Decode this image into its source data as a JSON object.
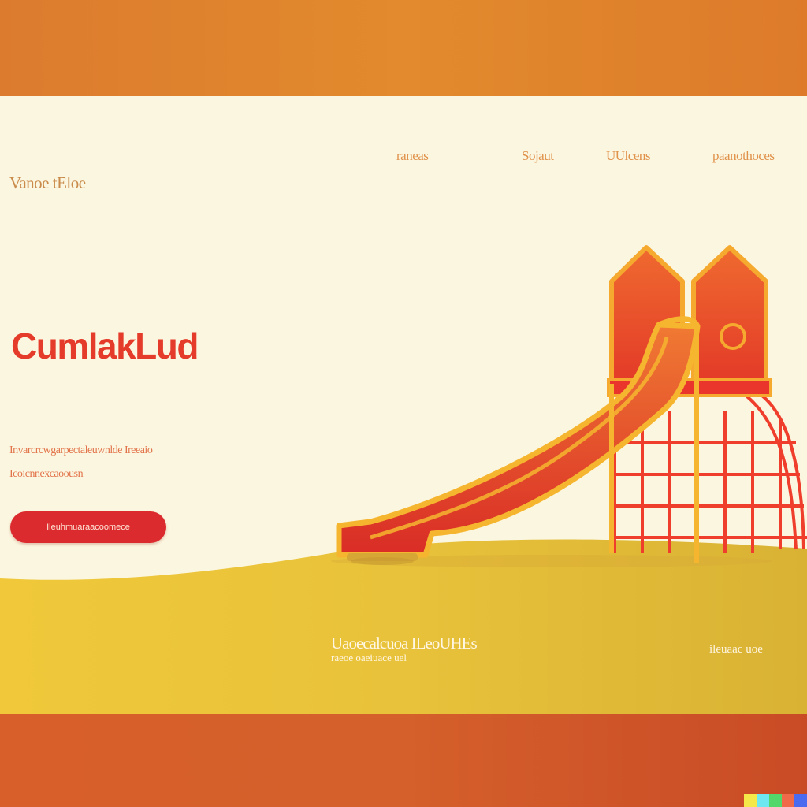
{
  "brand": {
    "name": "Vanoe tEloe"
  },
  "nav": {
    "items": [
      {
        "label": "raneas"
      },
      {
        "label": "Sojaut"
      },
      {
        "label": "UUlcens"
      },
      {
        "label": "paanothoces"
      }
    ]
  },
  "hero": {
    "title": "CumlakLud",
    "description_line1": "Invarcrcwgarpectaleuwnlde Ireeaio",
    "description_line2": "Icoicnnexcaoousn",
    "cta_label": "Ileuhmuaraacoomece"
  },
  "footer": {
    "headline": "Uaoecalcuoa ILeoUHEs",
    "subline": "raeoe oaeiuace uel",
    "right_text": "ileuaac uoe"
  },
  "colors": {
    "accent_red": "#dc2b2f",
    "title_red": "#e53b2a",
    "nav_orange": "#e0914a",
    "page_cream": "#fbf6df",
    "ground_yellow": "#ecc63a",
    "band_orange": "#e28a2d"
  },
  "icons": {
    "slide": "playground-slide-illustration"
  },
  "watermark_colors": [
    "#f5e94a",
    "#6ee8f0",
    "#52d86a",
    "#f06a4a",
    "#4a6af0"
  ]
}
